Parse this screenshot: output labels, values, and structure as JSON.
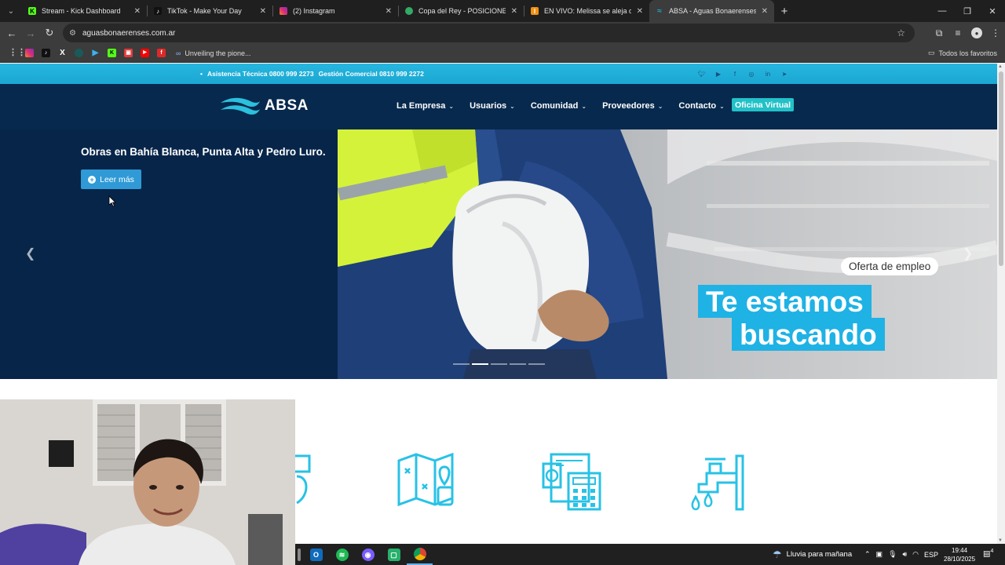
{
  "browser": {
    "tabs": [
      {
        "title": "Stream - Kick Dashboard",
        "favicon": "kick-icon",
        "color": "#53fc18"
      },
      {
        "title": "TikTok - Make Your Day",
        "favicon": "tiktok-icon",
        "color": "#111111"
      },
      {
        "title": "(2) Instagram",
        "favicon": "instagram-icon",
        "color": "#e1306c"
      },
      {
        "title": "Copa del Rey - POSICIONES, RE",
        "favicon": "globe-icon",
        "color": "#33aa66"
      },
      {
        "title": "EN VIVO: Melissa se aleja de Ja",
        "favicon": "news-icon",
        "color": "#f29111"
      },
      {
        "title": "ABSA - Aguas Bonaerenses S.A.",
        "favicon": "absa-icon",
        "color": "#1aa8d3"
      }
    ],
    "new_tab_symbol": "+",
    "address": "aguasbonaerenses.com.ar",
    "bookmarks_text": "Unveiling the pione...",
    "all_bookmarks": "Todos los favoritos"
  },
  "site": {
    "topbar": {
      "assist": "Asistencia Técnica 0800 999 2273",
      "commercial": "Gestión Comercial 0810 999 2272"
    },
    "logo": "ABSA",
    "menu": [
      "La Empresa",
      "Usuarios",
      "Comunidad",
      "Proveedores",
      "Contacto"
    ],
    "oficina": "Oficina Virtual",
    "hero": {
      "title": "Obras en Bahía Blanca, Punta Alta y Pedro Luro.",
      "button": "Leer más",
      "badge": "Oferta de empleo",
      "headline_1": "Te estamos",
      "headline_2": "buscando",
      "active_slide": 2,
      "slide_count": 5
    },
    "service_icons": [
      "phone-location-icon",
      "map-location-icon",
      "billing-calculator-icon",
      "water-faucet-icon"
    ]
  },
  "taskbar": {
    "weather": "Lluvia para mañana",
    "lang": "ESP",
    "time": "19:44",
    "date": "28/10/2025",
    "notifications": "4"
  },
  "colors": {
    "navy": "#07294d",
    "cyan": "#1aa8d3",
    "oficina": "#22c1c8",
    "icon_cyan": "#28c2e6"
  }
}
